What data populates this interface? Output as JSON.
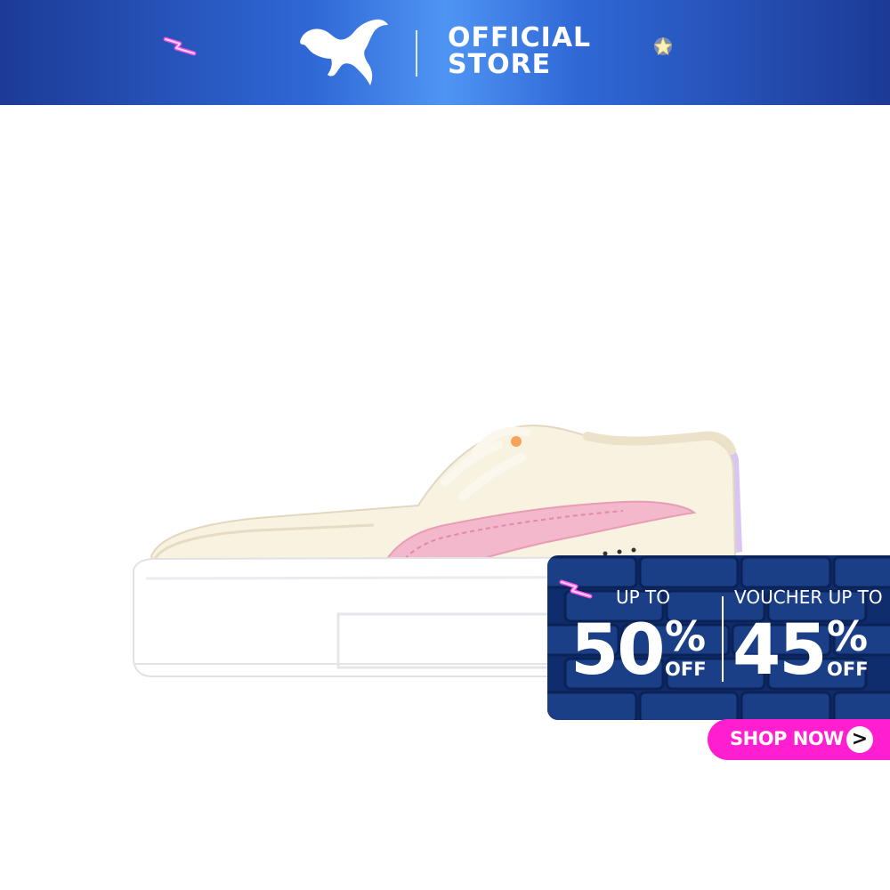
{
  "header": {
    "brand_logo": "puma-cat-logo",
    "store_line1": "OFFICIAL",
    "store_line2": "STORE",
    "colors": {
      "gradient_dark": "#1c3a96",
      "gradient_light": "#4f95f3"
    },
    "decorations": [
      "lightning-icon",
      "star-icon"
    ]
  },
  "product": {
    "image": "sneaker-cream-pink-lilac",
    "colors": {
      "upper": "#f8f2e1",
      "formstrip": "#f3b8cc",
      "heel": "#d8c6f0",
      "sole": "#ffffff"
    }
  },
  "promo": {
    "left": {
      "prefix": "UP TO",
      "value": "50",
      "percent": "%",
      "suffix": "OFF"
    },
    "right": {
      "prefix": "VOUCHER UP TO",
      "value": "45",
      "percent": "%",
      "suffix": "OFF"
    },
    "decoration": "lightning-icon",
    "colors": {
      "background": "#0f2c6c",
      "brick": "#1b3f86"
    }
  },
  "cta": {
    "label": "SHOP NOW",
    "arrow": ">",
    "colors": {
      "background": "#ff1ed0"
    }
  }
}
